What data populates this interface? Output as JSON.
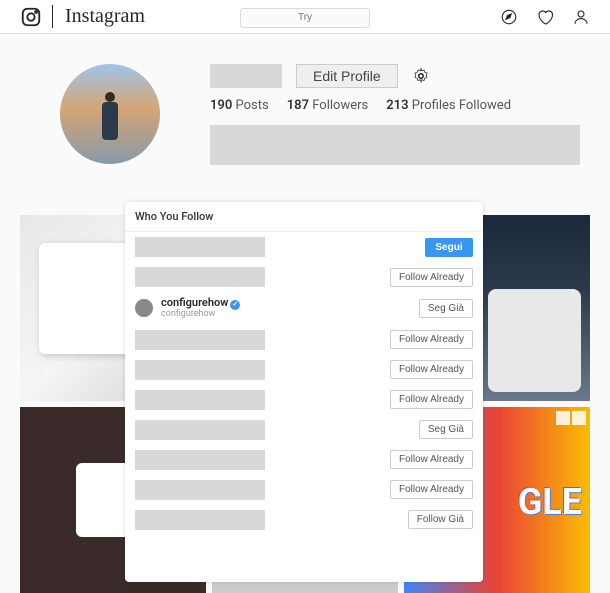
{
  "brand": "Instagram",
  "search": {
    "placeholder": "Try"
  },
  "profile": {
    "edit_label": "Edit Profile",
    "stats": {
      "posts_count": "190",
      "posts_label": "Posts",
      "followers_count": "187",
      "followers_label": "Followers",
      "following_count": "213",
      "following_label": "Profiles Followed"
    }
  },
  "modal": {
    "title": "Who You Follow",
    "rows": [
      {
        "placeholder": true,
        "button": "Segui",
        "primary": true
      },
      {
        "placeholder": true,
        "button": "Follow Already"
      },
      {
        "username": "configurehow",
        "handle": "configurehow",
        "verified": true,
        "button": "Seg Già"
      },
      {
        "placeholder": true,
        "button": "Follow Already"
      },
      {
        "placeholder": true,
        "button": "Follow Already"
      },
      {
        "placeholder": true,
        "button": "Follow Already"
      },
      {
        "placeholder": true,
        "button": "Seg Già"
      },
      {
        "placeholder": true,
        "button": "Follow Already"
      },
      {
        "placeholder": true,
        "button": "Follow Already"
      },
      {
        "placeholder": true,
        "button": "Follow Già"
      }
    ]
  }
}
